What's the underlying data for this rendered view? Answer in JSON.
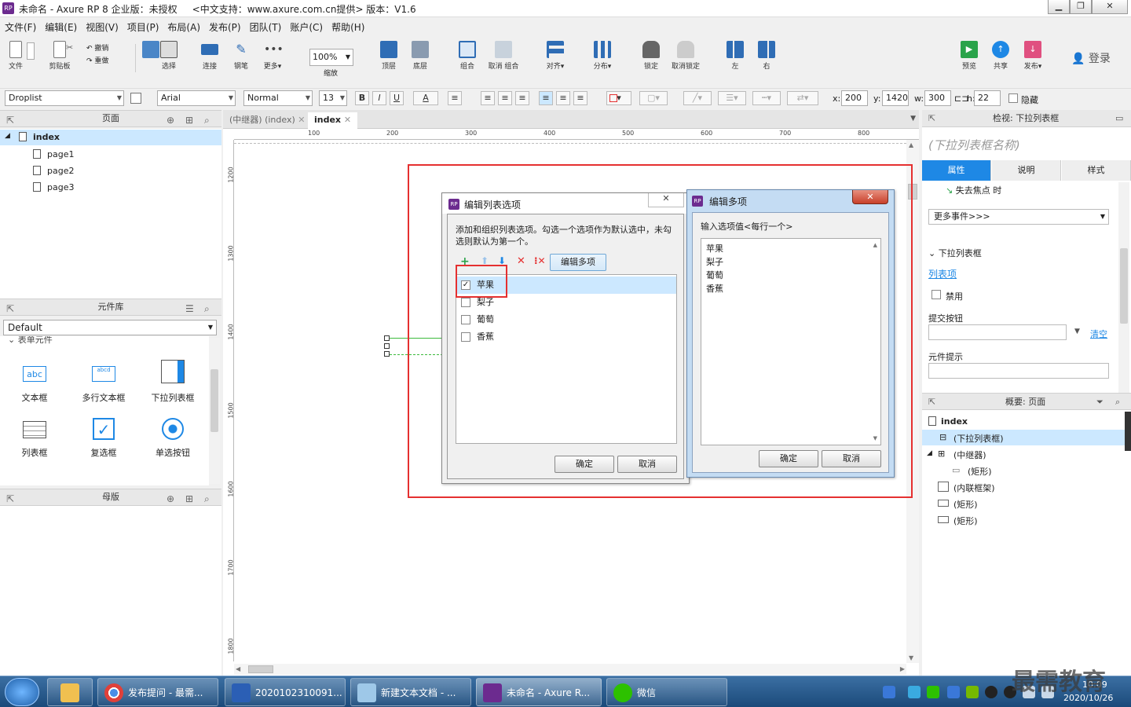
{
  "window": {
    "title": "未命名 - Axure RP 8 企业版：未授权     <中文支持：www.axure.com.cn提供> 版本：V1.6",
    "app_icon": "RP",
    "controls": [
      "minimize-icon",
      "maximize-icon",
      "close-icon"
    ]
  },
  "menu": [
    "文件(F)",
    "编辑(E)",
    "视图(V)",
    "项目(P)",
    "布局(A)",
    "发布(P)",
    "团队(T)",
    "账户(C)",
    "帮助(H)"
  ],
  "toolbar": {
    "file": "文件",
    "clipboard": "剪贴板",
    "undo": "撤销",
    "redo": "重做",
    "select": "选择",
    "connect": "连接",
    "pen": "钢笔",
    "more": "更多▾",
    "zoom_value": "100%",
    "zoom_label": "缩放",
    "top": "顶层",
    "bottom": "底层",
    "group": "组合",
    "ungroup": "取消 组合",
    "align": "对齐▾",
    "distribute": "分布▾",
    "lock": "锁定",
    "unlock": "取消锁定",
    "left": "左",
    "right": "右",
    "preview": "预览",
    "share": "共享",
    "publish": "发布▾",
    "login": "登录"
  },
  "formatbar": {
    "widget_type": "Droplist",
    "font": "Arial",
    "style": "Normal",
    "size": "13",
    "bold": "B",
    "italic": "I",
    "underline": "U",
    "font_color": "A",
    "x_label": "x:",
    "x": "200",
    "y_label": "y:",
    "y": "1420",
    "w_label": "w:",
    "w": "300",
    "h_label": "h:",
    "h": "22",
    "hidden": "隐藏"
  },
  "pages_panel": {
    "title": "页面",
    "root": "index",
    "children": [
      "page1",
      "page2",
      "page3"
    ]
  },
  "library_panel": {
    "title": "元件库",
    "selected_library": "Default",
    "group": "表单元件",
    "widgets": [
      {
        "label": "文本框",
        "icon": "textbox-icon",
        "icon_text": "abc"
      },
      {
        "label": "多行文本框",
        "icon": "textarea-icon",
        "icon_text": "abcd"
      },
      {
        "label": "下拉列表框",
        "icon": "droplist-icon",
        "icon_text": ""
      },
      {
        "label": "列表框",
        "icon": "listbox-icon",
        "icon_text": ""
      },
      {
        "label": "复选框",
        "icon": "checkbox-icon",
        "icon_text": ""
      },
      {
        "label": "单选按钮",
        "icon": "radio-icon",
        "icon_text": ""
      }
    ]
  },
  "masters_panel": {
    "title": "母版"
  },
  "canvas": {
    "tabs": [
      {
        "label": "(中继器) (index)",
        "active": false
      },
      {
        "label": "index",
        "active": true
      }
    ],
    "hruler": [
      "100",
      "200",
      "300",
      "400",
      "500",
      "600",
      "700",
      "800"
    ],
    "vruler": [
      "1200",
      "1300",
      "1400",
      "1500",
      "1600",
      "1700",
      "1800"
    ]
  },
  "dialog_list": {
    "title": "编辑列表选项",
    "description": "添加和组织列表选项。勾选一个选项作为默认选中，未勾选则默认为第一个。",
    "edit_multi_button": "编辑多项",
    "items": [
      {
        "label": "苹果",
        "checked": true
      },
      {
        "label": "梨子",
        "checked": false
      },
      {
        "label": "葡萄",
        "checked": false
      },
      {
        "label": "香蕉",
        "checked": false
      }
    ],
    "ok": "确定",
    "cancel": "取消"
  },
  "dialog_multi": {
    "title": "编辑多项",
    "prompt": "输入选项值<每行一个>",
    "lines": [
      "苹果",
      "梨子",
      "葡萄",
      "香蕉"
    ],
    "ok": "确定",
    "cancel": "取消"
  },
  "inspector": {
    "title": "检视: 下拉列表框",
    "name_placeholder": "(下拉列表框名称)",
    "tabs": [
      "属性",
      "说明",
      "样式"
    ],
    "event": "失去焦点 时",
    "more_events": "更多事件>>>",
    "section": "下拉列表框",
    "list_items_link": "列表项",
    "disabled": "禁用",
    "submit_button": "提交按钮",
    "clear": "清空",
    "tooltip": "元件提示"
  },
  "outline": {
    "title": "概要: 页面",
    "root": "index",
    "items": [
      {
        "label": "(下拉列表框)",
        "indent": 1,
        "selected": true,
        "icon": "droplist-icon"
      },
      {
        "label": "(中继器)",
        "indent": 1,
        "selected": false,
        "icon": "repeater-icon"
      },
      {
        "label": "(矩形)",
        "indent": 2,
        "selected": false,
        "icon": "line-icon"
      },
      {
        "label": "(内联框架)",
        "indent": 1,
        "selected": false,
        "icon": "iframe-icon"
      },
      {
        "label": "(矩形)",
        "indent": 1,
        "selected": false,
        "icon": "rectangle-icon"
      },
      {
        "label": "(矩形)",
        "indent": 1,
        "selected": false,
        "icon": "rectangle-icon"
      }
    ]
  },
  "taskbar": {
    "start": "start-icon",
    "tasks": [
      {
        "label": "",
        "icon": "explorer-icon"
      },
      {
        "label": "发布提问 - 最需...",
        "icon": "chrome-icon"
      },
      {
        "label": "2020102310091...",
        "icon": "word-icon"
      },
      {
        "label": "新建文本文档 - ...",
        "icon": "notepad-icon"
      },
      {
        "label": "未命名 - Axure R...",
        "icon": "axure-icon"
      },
      {
        "label": "微信",
        "icon": "wechat-icon"
      }
    ],
    "time": "10:09",
    "date": "2020/10/26",
    "watermark": "最需教育"
  },
  "colors": {
    "accent_blue": "#1e88e5",
    "highlight": "#cce8ff",
    "red_highlight": "#e53030",
    "axure_purple": "#6c2b8f"
  }
}
